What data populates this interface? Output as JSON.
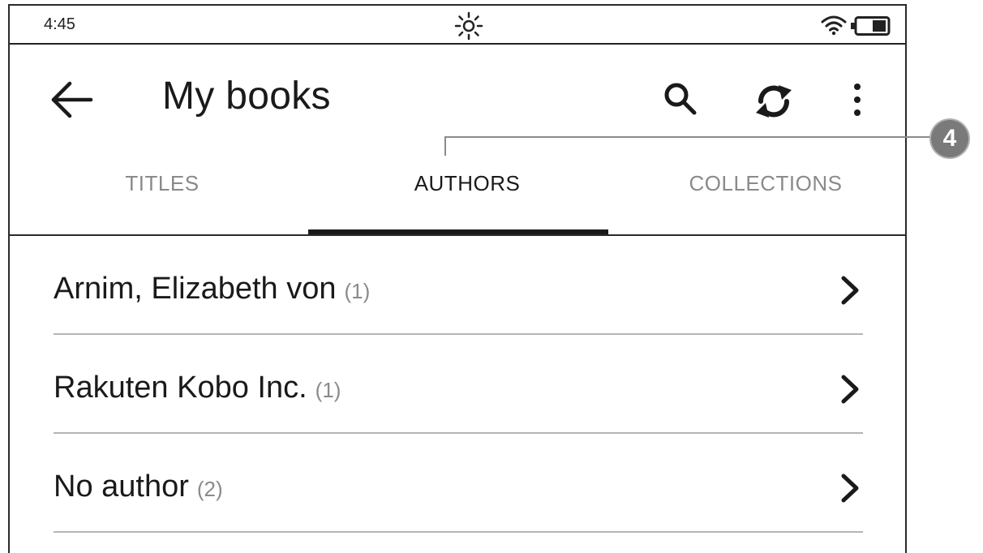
{
  "status_bar": {
    "time": "4:45",
    "light_icon": "sun-icon",
    "wifi_icon": "wifi-icon",
    "battery_icon": "battery-icon"
  },
  "header": {
    "title": "My books",
    "back_icon": "arrow-left-icon",
    "search_icon": "search-icon",
    "sync_icon": "sync-icon",
    "more_icon": "more-vertical-icon"
  },
  "tabs": [
    {
      "label": "TITLES",
      "active": false
    },
    {
      "label": "AUTHORS",
      "active": true
    },
    {
      "label": "COLLECTIONS",
      "active": false
    }
  ],
  "callout": {
    "number": "4"
  },
  "authors": [
    {
      "name": "Arnim, Elizabeth von",
      "count": "(1)"
    },
    {
      "name": "Rakuten Kobo Inc.",
      "count": "(1)"
    },
    {
      "name": "No author",
      "count": "(2)"
    }
  ],
  "colors": {
    "text": "#1a1a1a",
    "muted": "#8a8a8a",
    "divider": "#b5b5b5",
    "callout": "#7a7a7a"
  }
}
